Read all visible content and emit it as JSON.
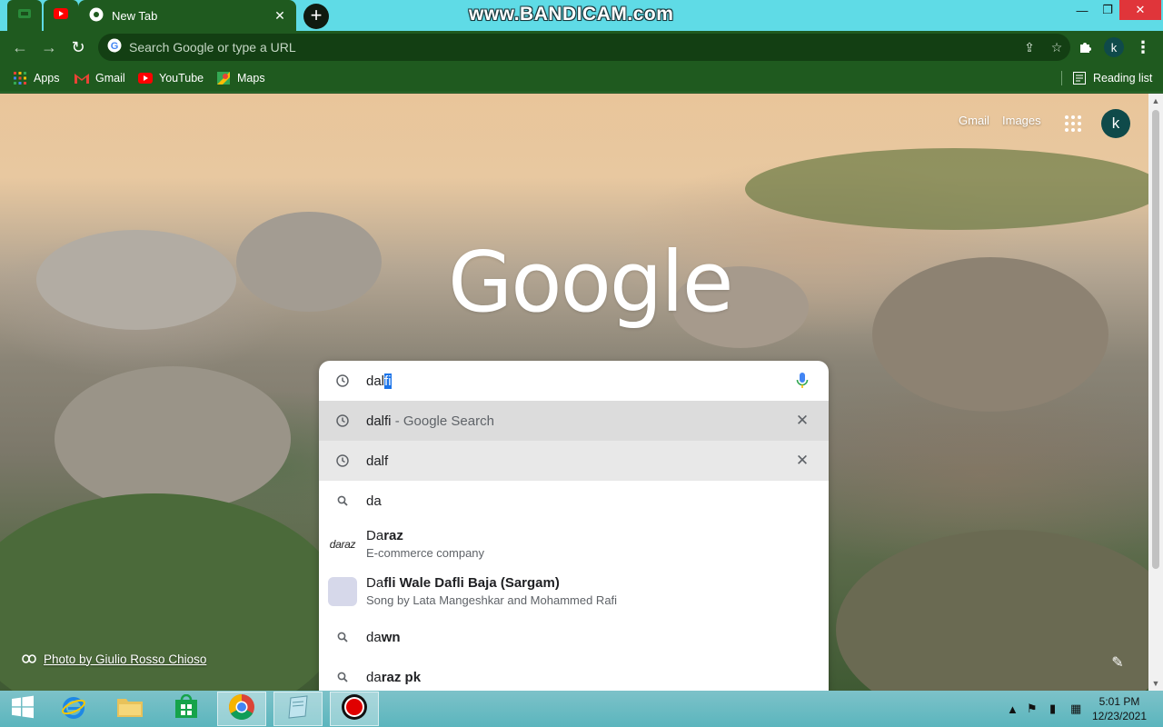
{
  "watermark": "www.BANDICAM.com",
  "tabs": {
    "active_title": "New Tab",
    "new_tab_label": "+"
  },
  "omnibox": {
    "placeholder": "Search Google or type a URL"
  },
  "bookmarks": [
    {
      "label": "Apps",
      "icon": "apps-grid-icon"
    },
    {
      "label": "Gmail",
      "icon": "gmail-icon"
    },
    {
      "label": "YouTube",
      "icon": "youtube-icon"
    },
    {
      "label": "Maps",
      "icon": "maps-icon"
    }
  ],
  "reading_list": "Reading list",
  "profile_initial": "k",
  "ntp": {
    "logo": "Google",
    "links": {
      "gmail": "Gmail",
      "images": "Images"
    },
    "account_initial": "k",
    "photo_credit": "Photo by Giulio Rosso Chioso"
  },
  "search": {
    "input_typed": "dal",
    "input_selected": "fi",
    "suggestions": [
      {
        "type": "history",
        "query": "dalfi",
        "suffix": " - Google Search",
        "removable": true,
        "state": "selected"
      },
      {
        "type": "history",
        "query": "dalf",
        "removable": true,
        "state": "hover"
      },
      {
        "type": "search",
        "typed": "da",
        "completion": ""
      },
      {
        "type": "entity",
        "typed": "Da",
        "completion": "raz",
        "description": "E-commerce company",
        "logo_text": "daraz"
      },
      {
        "type": "entity",
        "typed": "Da",
        "completion": "fli Wale Dafli Baja (Sargam)",
        "description": "Song by Lata Mangeshkar and Mohammed Rafi"
      },
      {
        "type": "search",
        "typed": "da",
        "completion": "wn"
      },
      {
        "type": "search",
        "typed": "da",
        "completion": "raz pk"
      }
    ]
  },
  "taskbar": {
    "clock_time": "5:01 PM",
    "clock_date": "12/23/2021"
  },
  "colors": {
    "tab_strip": "#5fdbe6",
    "frame": "#1f5a1f",
    "close_button": "#e0353a",
    "selection": "#1a73e8"
  }
}
